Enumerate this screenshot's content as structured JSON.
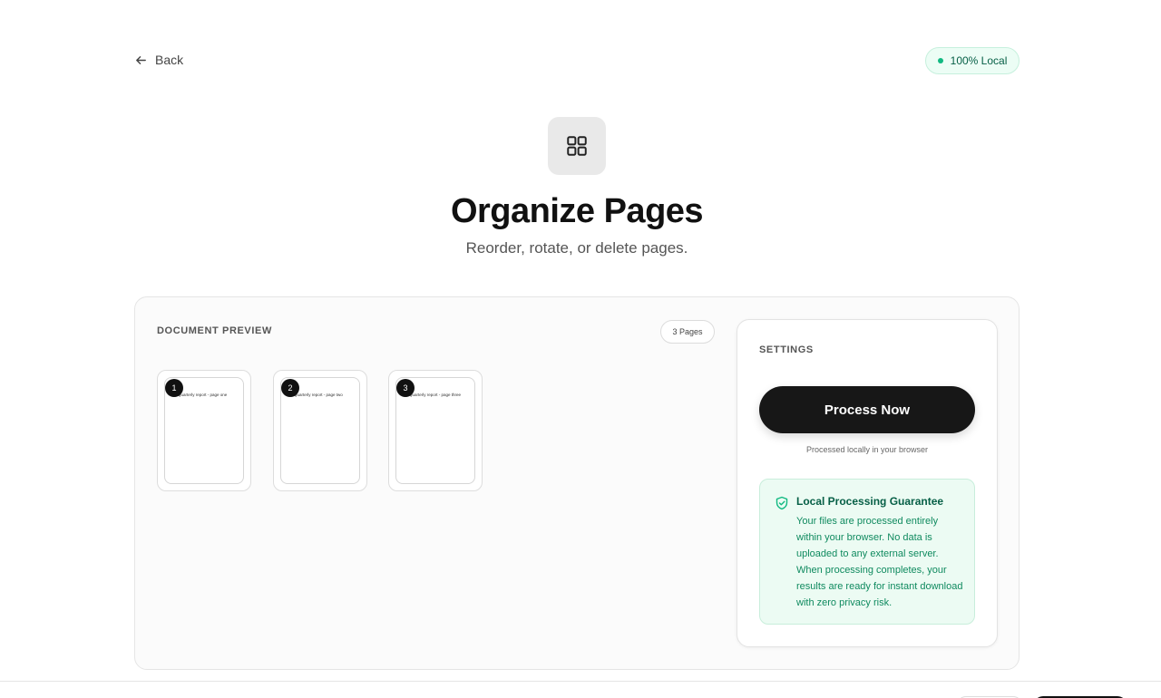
{
  "header": {
    "back_label": "Back",
    "badge_label": "100% Local"
  },
  "hero": {
    "icon": "grid-icon",
    "title": "Organize Pages",
    "subtitle": "Reorder, rotate, or delete pages."
  },
  "preview": {
    "label": "DOCUMENT PREVIEW",
    "pages_count": "3 Pages",
    "pages": [
      {
        "number": "1",
        "text": "Quarterly report - page one"
      },
      {
        "number": "2",
        "text": "Quarterly report - page two"
      },
      {
        "number": "3",
        "text": "Quarterly report - page three"
      }
    ]
  },
  "settings": {
    "label": "SETTINGS",
    "process_button": "Process Now",
    "processed_note": "Processed locally in your browser",
    "guarantee_title": "Local Processing Guarantee",
    "guarantee_body": "Your files are processed entirely within your browser. No data is uploaded to any external server. When processing completes, your results are ready for instant download with zero privacy risk."
  },
  "colors": {
    "accent_dark": "#171717",
    "success_green": "#10b981",
    "success_text": "#065f46",
    "success_bg": "#ecfbf3"
  }
}
